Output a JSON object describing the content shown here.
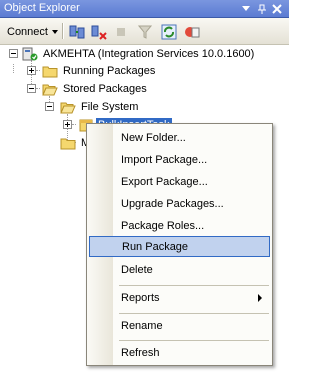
{
  "window": {
    "title": "Object Explorer"
  },
  "toolbar": {
    "connect_label": "Connect",
    "tools": [
      "connect-object-explorer-icon",
      "disconnect-icon",
      "stop-icon",
      "filter-icon",
      "refresh-icon",
      "summary-icon"
    ]
  },
  "tree": {
    "server": "AKMEHTA (Integration Services 10.0.1600)",
    "running_packages": "Running Packages",
    "stored_packages": "Stored Packages",
    "file_system": "File System",
    "bulk_insert_task": "BulkInsertTask",
    "msdb_partial": "M"
  },
  "context_menu": {
    "items": [
      {
        "label": "New Folder..."
      },
      {
        "label": "Import Package..."
      },
      {
        "label": "Export Package..."
      },
      {
        "label": "Upgrade Packages..."
      },
      {
        "label": "Package Roles..."
      },
      {
        "label": "Run Package"
      },
      {
        "label": "Delete"
      },
      {
        "label": "Reports"
      },
      {
        "label": "Rename"
      },
      {
        "label": "Refresh"
      }
    ],
    "highlighted": "Run Package"
  },
  "colors": {
    "title_bar": "#5b7bd2",
    "selection": "#316ac5",
    "menu_hover": "#c1d2ee",
    "folder": "#f5d76e"
  }
}
